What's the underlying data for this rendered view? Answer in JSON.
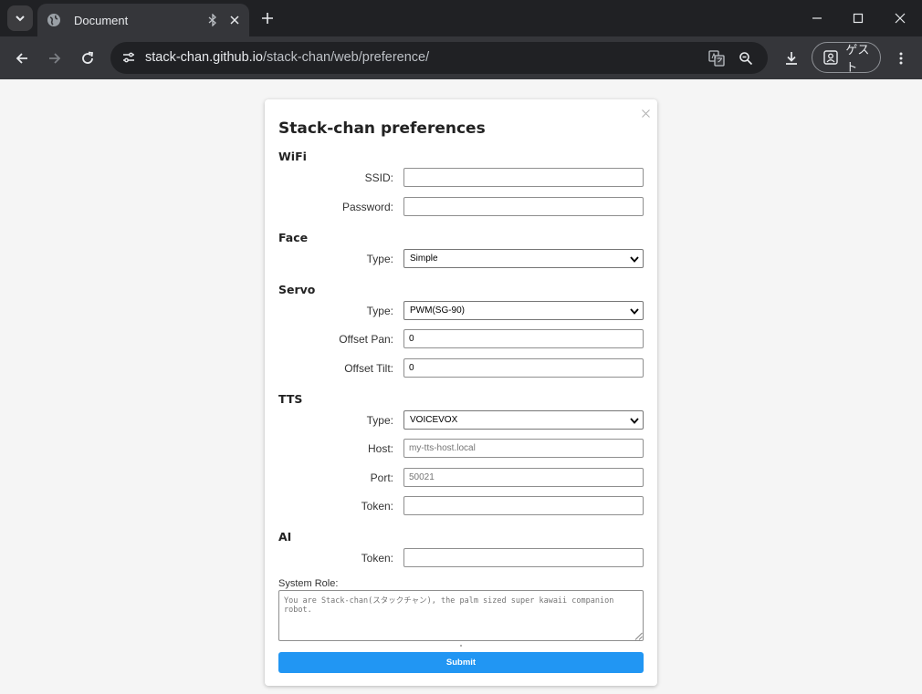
{
  "browser": {
    "tab": {
      "title": "Document"
    },
    "url": {
      "host": "stack-chan.github.io",
      "path": "/stack-chan/web/preference/"
    },
    "profile": {
      "label": "ゲスト"
    },
    "icons": {
      "tab_search": "chevron-down-icon",
      "favicon": "globe-icon",
      "bluetooth": "bluetooth-icon",
      "tab_close": "close-icon",
      "new_tab": "plus-icon",
      "back": "arrow-left-icon",
      "forward": "arrow-right-icon",
      "reload": "reload-icon",
      "site_info": "tune-icon",
      "translate": "translate-icon",
      "zoom": "zoom-icon",
      "download": "download-icon",
      "profile": "person-icon",
      "menu": "kebab-icon",
      "minimize": "minimize-icon",
      "maximize": "maximize-icon",
      "close_window": "close-icon"
    }
  },
  "dialog": {
    "title": "Stack-chan preferences",
    "wifi": {
      "heading": "WiFi",
      "ssid_label": "SSID:",
      "ssid_value": "",
      "password_label": "Password:",
      "password_value": ""
    },
    "face": {
      "heading": "Face",
      "type_label": "Type:",
      "type_value": "Simple"
    },
    "servo": {
      "heading": "Servo",
      "type_label": "Type:",
      "type_value": "PWM(SG-90)",
      "offset_pan_label": "Offset Pan:",
      "offset_pan_value": "0",
      "offset_tilt_label": "Offset Tilt:",
      "offset_tilt_value": "0"
    },
    "tts": {
      "heading": "TTS",
      "type_label": "Type:",
      "type_value": "VOICEVOX",
      "host_label": "Host:",
      "host_placeholder": "my-tts-host.local",
      "port_label": "Port:",
      "port_placeholder": "50021",
      "token_label": "Token:",
      "token_value": ""
    },
    "ai": {
      "heading": "AI",
      "token_label": "Token:",
      "token_value": ""
    },
    "system_role": {
      "label": "System Role:",
      "placeholder": "You are Stack-chan(スタックチャン), the palm sized super kawaii companion robot."
    },
    "submit_label": "Submit"
  },
  "colors": {
    "accent": "#2196f3",
    "chrome_dark": "#202124",
    "chrome_toolbar": "#35363a",
    "page_bg": "#f5f5f5"
  }
}
